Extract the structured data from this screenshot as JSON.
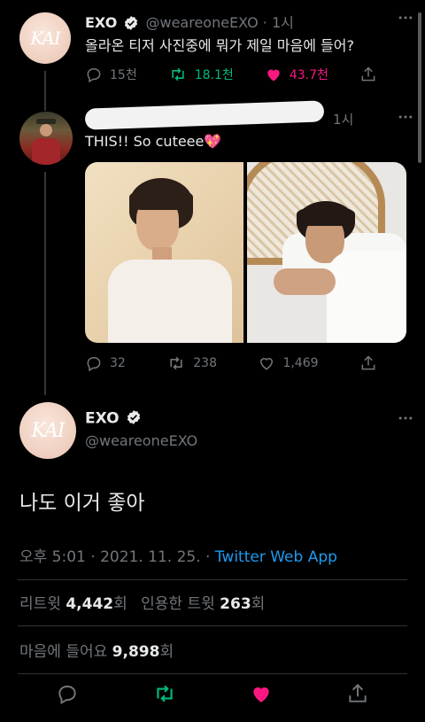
{
  "tweet1": {
    "display_name": "EXO",
    "handle": "@weareoneEXO",
    "time": "· 1시",
    "text": "올라온 티저 사진중에 뭐가 제일 마음에 들어?",
    "avatar_text": "KAI",
    "replies": "15천",
    "retweets": "18.1천",
    "likes": "43.7천"
  },
  "tweet2": {
    "time": "1시",
    "text": "THIS!! So cuteee💖",
    "replies": "32",
    "retweets": "238",
    "likes": "1,469"
  },
  "main": {
    "display_name": "EXO",
    "handle": "@weareoneEXO",
    "avatar_text": "KAI",
    "text": "나도 이거 좋아",
    "timestamp": "오후 5:01 · 2021. 11. 25. · ",
    "source": "Twitter Web App",
    "retweet_label": "리트윗",
    "retweet_count": "4,442",
    "retweet_unit": "회",
    "quote_label": "인용한 트윗",
    "quote_count": "263",
    "quote_unit": "회",
    "like_label": "마음에 들어요",
    "like_count": "9,898",
    "like_unit": "회"
  },
  "colors": {
    "background": "#000000",
    "text": "#e7e9ea",
    "muted": "#71767b",
    "link": "#1d9bf0",
    "retweet_active": "#00ba7c",
    "like_active": "#f91880"
  }
}
